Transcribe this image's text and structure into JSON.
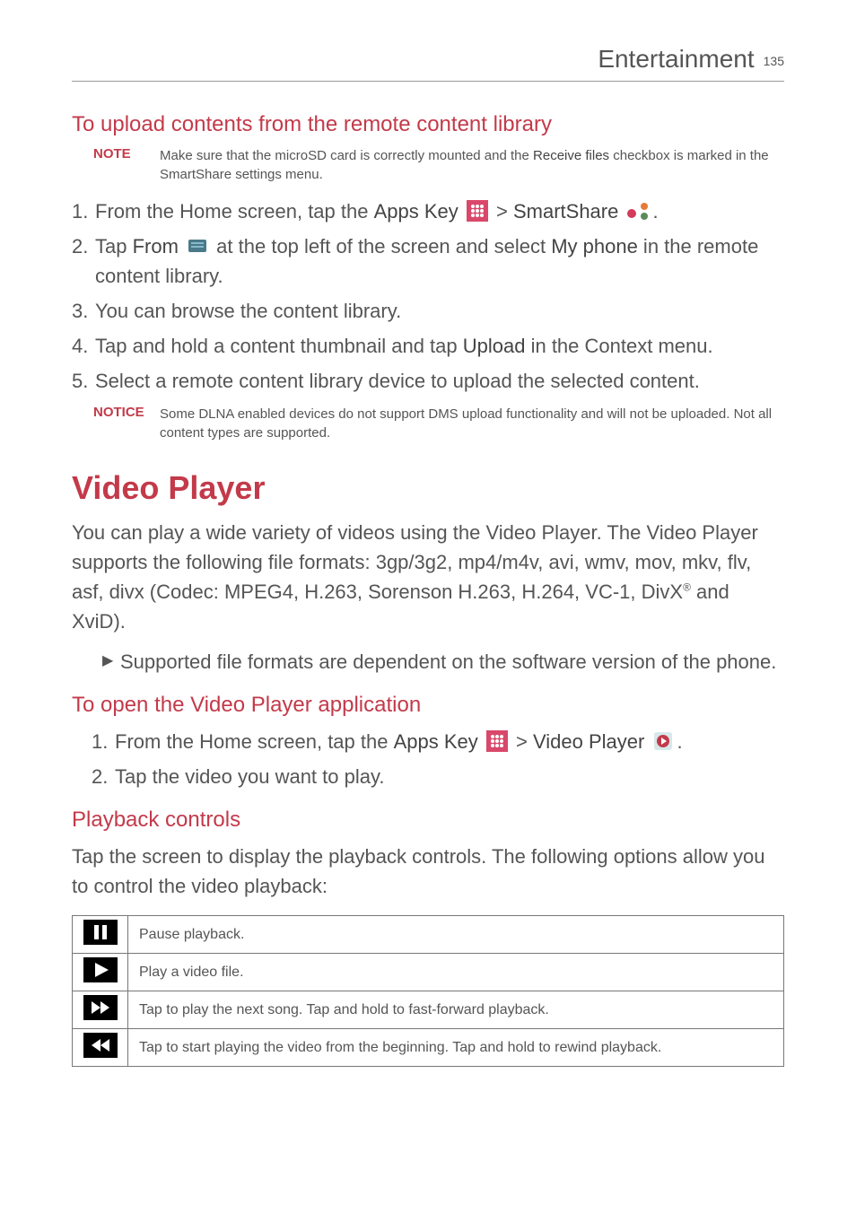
{
  "header": {
    "title": "Entertainment",
    "page": "135"
  },
  "sec1": {
    "heading": "To upload contents from the remote content library",
    "note_label": "NOTE",
    "note_text_a": "Make sure that the microSD card is correctly mounted and the ",
    "note_bold": "Receive files",
    "note_text_b": " checkbox is marked in the SmartShare settings menu.",
    "step1_a": "From the Home screen, tap the ",
    "step1_b": "Apps Key",
    "step1_c": " > ",
    "step1_d": "SmartShare",
    "step1_e": ".",
    "step2_a": "Tap ",
    "step2_b": "From",
    "step2_c": " at the top left of the screen and select ",
    "step2_d": "My phone",
    "step2_e": " in the remote content library.",
    "step3": "You can browse the content library.",
    "step4_a": "Tap and hold a content thumbnail and tap ",
    "step4_b": "Upload",
    "step4_c": " in the Context menu.",
    "step5": "Select a remote content library device to upload the selected content.",
    "notice_label": "NOTICE",
    "notice_text": "Some DLNA enabled devices do not support DMS upload functionality and will not be uploaded. Not all content types are supported."
  },
  "sec2": {
    "title": "Video Player",
    "para_a": "You can play a wide variety of videos using the Video Player. The Video Player supports the following file formats: 3gp/3g2, mp4/m4v, avi, wmv, mov, mkv, flv, asf, divx (Codec: MPEG4, H.263, Sorenson H.263, H.264, VC-1, DivX",
    "para_sup": "®",
    "para_b": " and XviD).",
    "bullet": "Supported file formats are dependent on the software version of the phone."
  },
  "sec3": {
    "heading": "To open the Video Player application",
    "step1_a": "From the Home screen, tap the ",
    "step1_b": "Apps Key",
    "step1_c": " > ",
    "step1_d": "Video Player",
    "step1_e": ".",
    "step2": "Tap the video you want to play."
  },
  "sec4": {
    "heading": "Playback controls",
    "para": "Tap the screen to display the playback controls. The following options allow you to control the video playback:",
    "rows": [
      "Pause playback.",
      "Play a video file.",
      "Tap to play the next song. Tap and hold to fast-forward playback.",
      "Tap to start playing the video from the beginning. Tap and hold to rewind playback."
    ]
  },
  "nums": {
    "n1": "1.",
    "n2": "2.",
    "n3": "3.",
    "n4": "4.",
    "n5": "5."
  }
}
